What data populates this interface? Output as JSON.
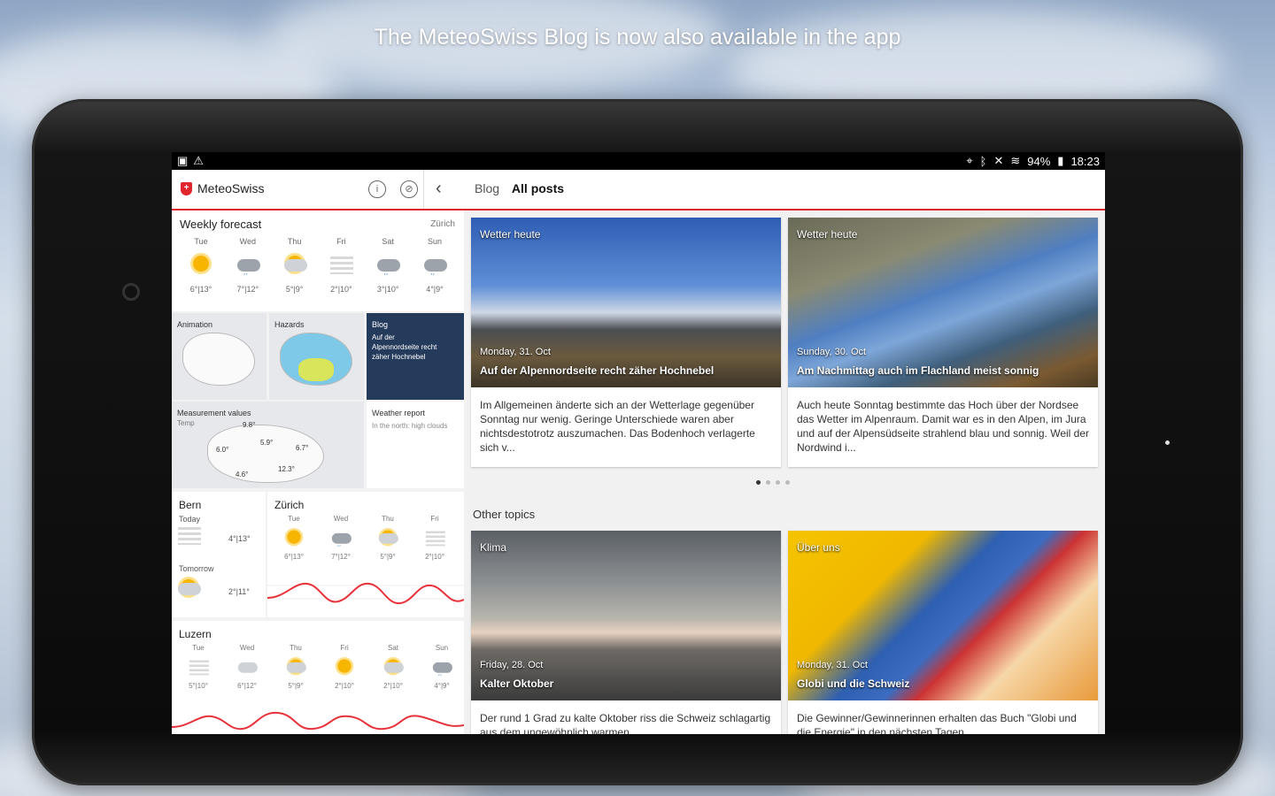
{
  "headline": "The MeteoSwiss Blog is now also available in the app",
  "status": {
    "battery": "94%",
    "time": "18:23"
  },
  "appbar": {
    "app_name": "MeteoSwiss",
    "section": "Blog",
    "subsection": "All posts"
  },
  "weekly": {
    "title": "Weekly forecast",
    "location": "Zürich",
    "days": [
      {
        "day": "Tue",
        "temp": "6°|13°",
        "icon": "sun"
      },
      {
        "day": "Wed",
        "temp": "7°|12°",
        "icon": "cloud-rain"
      },
      {
        "day": "Thu",
        "temp": "5°|9°",
        "icon": "sun-cloud"
      },
      {
        "day": "Fri",
        "temp": "2°|10°",
        "icon": "fog"
      },
      {
        "day": "Sat",
        "temp": "3°|10°",
        "icon": "cloud-rain"
      },
      {
        "day": "Sun",
        "temp": "4°|9°",
        "icon": "cloud-rain"
      }
    ]
  },
  "tiles": {
    "animation": "Animation",
    "hazards": "Hazards",
    "blog": "Blog",
    "blog_text": "Auf der Alpennordseite recht zäher Hochnebel",
    "measurement": "Measurement values",
    "measurement_sub": "Temp",
    "measure_values": [
      "9.8°",
      "5.9°",
      "6.7°",
      "6.0°",
      "12.3°",
      "4.6°"
    ],
    "report": "Weather report",
    "report_text": "In the north: high clouds"
  },
  "bern": {
    "name": "Bern",
    "today": "Today",
    "today_temp": "4°|13°",
    "tomorrow": "Tomorrow",
    "tomorrow_temp": "2°|11°"
  },
  "zurich": {
    "name": "Zürich",
    "days": [
      {
        "day": "Tue",
        "temp": "6°|13°",
        "icon": "sun"
      },
      {
        "day": "Wed",
        "temp": "7°|12°",
        "icon": "cloud-rain"
      },
      {
        "day": "Thu",
        "temp": "5°|9°",
        "icon": "sun-cloud"
      },
      {
        "day": "Fri",
        "temp": "2°|10°",
        "icon": "fog"
      }
    ]
  },
  "luzern": {
    "name": "Luzern",
    "days": [
      {
        "day": "Tue",
        "temp": "5°|10°",
        "icon": "fog"
      },
      {
        "day": "Wed",
        "temp": "6°|12°",
        "icon": "cloud"
      },
      {
        "day": "Thu",
        "temp": "5°|9°",
        "icon": "sun-cloud"
      },
      {
        "day": "Fri",
        "temp": "2°|10°",
        "icon": "sun"
      },
      {
        "day": "Sat",
        "temp": "2°|10°",
        "icon": "sun-cloud"
      },
      {
        "day": "Sun",
        "temp": "4°|9°",
        "icon": "cloud-rain"
      }
    ]
  },
  "posts": [
    {
      "category": "Wetter heute",
      "date": "Monday, 31. Oct",
      "title": "Auf der Alpennordseite recht zäher Hochnebel",
      "text": "Im Allgemeinen änderte sich an der Wetterlage gegenüber Sonntag nur wenig. Geringe Unterschiede waren aber nichtsdestotrotz auszumachen. Das Bodenhoch verlagerte sich v..."
    },
    {
      "category": "Wetter heute",
      "date": "Sunday, 30. Oct",
      "title": "Am Nachmittag auch im Flachland meist sonnig",
      "text": "Auch heute Sonntag bestimmte das Hoch über der Nordsee das Wetter im Alpenraum. Damit war es in den Alpen, im Jura und auf der Alpensüdseite strahlend blau und sonnig. Weil der Nordwind i..."
    }
  ],
  "other_topics": "Other topics",
  "topics": [
    {
      "category": "Klima",
      "date": "Friday, 28. Oct",
      "title": "Kalter Oktober",
      "text": "Der rund 1 Grad zu kalte Oktober riss die Schweiz schlagartig aus dem ungewöhnlich warmen"
    },
    {
      "category": "Über uns",
      "date": "Monday, 31. Oct",
      "title": "Globi und die Schweiz",
      "text": "Die Gewinner/Gewinnerinnen erhalten das Buch \"Globi und die Energie\" in den nächsten Tagen"
    }
  ],
  "colors": {
    "accent": "#e0262c",
    "curve": "#e8323a"
  }
}
